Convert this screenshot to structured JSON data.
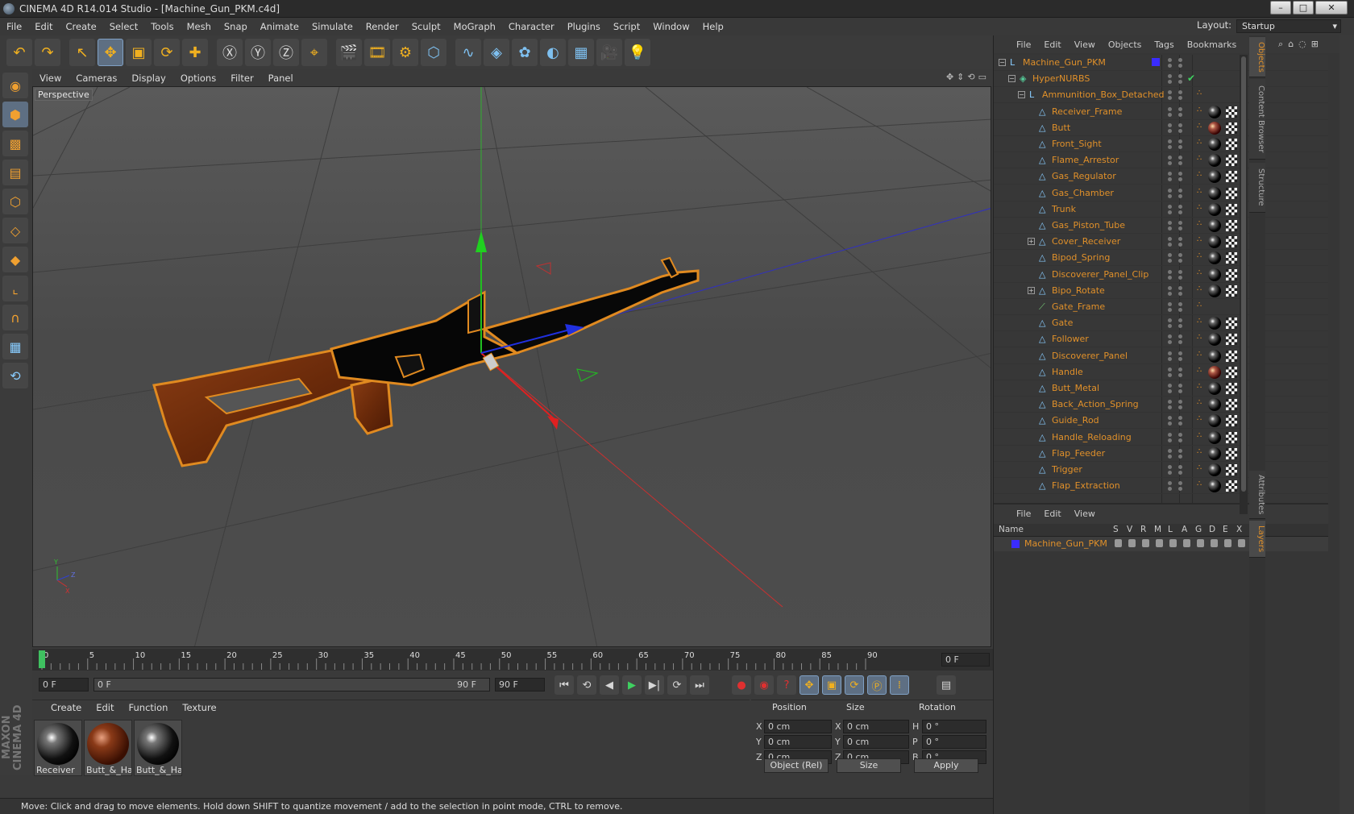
{
  "window": {
    "title": "CINEMA 4D R14.014 Studio - [Machine_Gun_PKM.c4d]",
    "min": "–",
    "max": "□",
    "close": "✕"
  },
  "menu": [
    "File",
    "Edit",
    "Create",
    "Select",
    "Tools",
    "Mesh",
    "Snap",
    "Animate",
    "Simulate",
    "Render",
    "Sculpt",
    "MoGraph",
    "Character",
    "Plugins",
    "Script",
    "Window",
    "Help"
  ],
  "layout": {
    "label": "Layout:",
    "value": "Startup"
  },
  "toolbar_icons": [
    "undo-icon",
    "redo-icon",
    "live-selection-icon",
    "move-icon",
    "scale-icon",
    "rotate-icon",
    "last-tool-icon",
    "x-axis-icon",
    "y-axis-icon",
    "z-axis-icon",
    "coordinate-system-icon",
    "render-view-icon",
    "render-picture-viewer-icon",
    "render-settings-icon",
    "cube-icon",
    "spline-icon",
    "nurbs-icon",
    "array-icon",
    "deformer-icon",
    "floor-icon",
    "camera-icon",
    "light-icon"
  ],
  "toolbar_glyphs": [
    "↶",
    "↷",
    "↖",
    "✥",
    "▣",
    "⟳",
    "✚",
    "Ⓧ",
    "Ⓨ",
    "Ⓩ",
    "⌖",
    "🎬",
    "🎞",
    "⚙",
    "⬡",
    "∿",
    "◈",
    "✿",
    "◐",
    "▦",
    "🎥",
    "💡"
  ],
  "left_tools": [
    "make-editable-icon",
    "model-mode-icon",
    "texture-mode-icon",
    "workplane-icon",
    "points-mode-icon",
    "edges-mode-icon",
    "polygons-mode-icon",
    "axis-mode-icon",
    "magnet-icon",
    "snap-grid-icon",
    "locked-workplane-icon"
  ],
  "left_glyphs": [
    "◉",
    "⬢",
    "▩",
    "▤",
    "⬡",
    "◇",
    "◆",
    "⌞",
    "∩",
    "▦",
    "⟲"
  ],
  "branding": "MAXON CINEMA 4D",
  "viewport": {
    "menu": [
      "View",
      "Cameras",
      "Display",
      "Options",
      "Filter",
      "Panel"
    ],
    "label": "Perspective",
    "icons": [
      "✥",
      "⇕",
      "⟲",
      "▭"
    ],
    "axis_labels": {
      "y": "Y",
      "x": "X",
      "z": "Z"
    }
  },
  "timeline": {
    "ticks": [
      "0",
      "5",
      "10",
      "15",
      "20",
      "25",
      "30",
      "35",
      "40",
      "45",
      "50",
      "55",
      "60",
      "65",
      "70",
      "75",
      "80",
      "85",
      "90"
    ],
    "current_frame": "0 F",
    "start_field": "0 F",
    "range_start": "0 F",
    "range_end": "90 F",
    "end_field": "90 F",
    "controls": [
      "⏮",
      "⟲",
      "◀",
      "▶",
      "▶|",
      "⟳",
      "⏭"
    ],
    "rec_icons": [
      "●",
      "◉",
      "?"
    ],
    "key_icons": [
      "✥",
      "▣",
      "⟳",
      "Ⓟ",
      "⁞"
    ],
    "timeline_icon": "▤"
  },
  "materials": {
    "menu": [
      "Create",
      "Edit",
      "Function",
      "Texture"
    ],
    "items": [
      {
        "name": "Receiver",
        "type": "black"
      },
      {
        "name": "Butt_&_Ha",
        "type": "wood"
      },
      {
        "name": "Butt_&_Ha",
        "type": "black"
      }
    ]
  },
  "coordinates": {
    "headers": [
      "Position",
      "Size",
      "Rotation"
    ],
    "rows": [
      {
        "pl": "X",
        "pv": "0 cm",
        "sl": "X",
        "sv": "0 cm",
        "rl": "H",
        "rv": "0 °"
      },
      {
        "pl": "Y",
        "pv": "0 cm",
        "sl": "Y",
        "sv": "0 cm",
        "rl": "P",
        "rv": "0 °"
      },
      {
        "pl": "Z",
        "pv": "0 cm",
        "sl": "Z",
        "sv": "0 cm",
        "rl": "B",
        "rv": "0 °"
      }
    ],
    "mode": "Object (Rel)",
    "size_mode": "Size",
    "apply": "Apply"
  },
  "status": "Move: Click and drag to move elements. Hold down SHIFT to quantize movement / add to the selection in point mode, CTRL to remove.",
  "objects": {
    "menu": [
      "File",
      "Edit",
      "View",
      "Objects",
      "Tags",
      "Bookmarks"
    ],
    "search_icons": [
      "⌕",
      "⌂",
      "◌",
      "⊞"
    ],
    "tree": [
      {
        "name": "Machine_Gun_PKM",
        "level": 0,
        "icon": "null",
        "tags": "layer",
        "expand": "−"
      },
      {
        "name": "HyperNURBS",
        "level": 1,
        "icon": "nurbs",
        "tags": "check",
        "expand": "−"
      },
      {
        "name": "Ammunition_Box_Detached",
        "level": 2,
        "icon": "null",
        "tags": "phong",
        "expand": "−"
      },
      {
        "name": "Receiver_Frame",
        "level": 3,
        "icon": "poly",
        "tags": "black"
      },
      {
        "name": "Butt",
        "level": 3,
        "icon": "poly",
        "tags": "brown"
      },
      {
        "name": "Front_Sight",
        "level": 3,
        "icon": "poly",
        "tags": "black"
      },
      {
        "name": "Flame_Arrestor",
        "level": 3,
        "icon": "poly",
        "tags": "black"
      },
      {
        "name": "Gas_Regulator",
        "level": 3,
        "icon": "poly",
        "tags": "black"
      },
      {
        "name": "Gas_Chamber",
        "level": 3,
        "icon": "poly",
        "tags": "black"
      },
      {
        "name": "Trunk",
        "level": 3,
        "icon": "poly",
        "tags": "black"
      },
      {
        "name": "Gas_Piston_Tube",
        "level": 3,
        "icon": "poly",
        "tags": "black"
      },
      {
        "name": "Cover_Receiver",
        "level": 3,
        "icon": "poly",
        "tags": "black",
        "expand": "+"
      },
      {
        "name": "Bipod_Spring",
        "level": 3,
        "icon": "poly",
        "tags": "black"
      },
      {
        "name": "Discoverer_Panel_Clip",
        "level": 3,
        "icon": "poly",
        "tags": "black"
      },
      {
        "name": "Bipo_Rotate",
        "level": 3,
        "icon": "poly",
        "tags": "black",
        "expand": "+"
      },
      {
        "name": "Gate_Frame",
        "level": 3,
        "icon": "spline",
        "tags": "phong"
      },
      {
        "name": "Gate",
        "level": 3,
        "icon": "poly",
        "tags": "black"
      },
      {
        "name": "Follower",
        "level": 3,
        "icon": "poly",
        "tags": "black"
      },
      {
        "name": "Discoverer_Panel",
        "level": 3,
        "icon": "poly",
        "tags": "black"
      },
      {
        "name": "Handle",
        "level": 3,
        "icon": "poly",
        "tags": "brown"
      },
      {
        "name": "Butt_Metal",
        "level": 3,
        "icon": "poly",
        "tags": "black"
      },
      {
        "name": "Back_Action_Spring",
        "level": 3,
        "icon": "poly",
        "tags": "black"
      },
      {
        "name": "Guide_Rod",
        "level": 3,
        "icon": "poly",
        "tags": "black"
      },
      {
        "name": "Handle_Reloading",
        "level": 3,
        "icon": "poly",
        "tags": "black"
      },
      {
        "name": "Flap_Feeder",
        "level": 3,
        "icon": "poly",
        "tags": "black"
      },
      {
        "name": "Trigger",
        "level": 3,
        "icon": "poly",
        "tags": "black"
      },
      {
        "name": "Flap_Extraction",
        "level": 3,
        "icon": "poly",
        "tags": "black"
      }
    ]
  },
  "side_tabs": [
    "Objects",
    "Content Browser",
    "Structure",
    "Attributes",
    "Layers"
  ],
  "layers": {
    "menu": [
      "File",
      "Edit",
      "View"
    ],
    "columns": [
      "Name",
      "S",
      "V",
      "R",
      "M",
      "L",
      "A",
      "G",
      "D",
      "E",
      "X"
    ],
    "row": {
      "name": "Machine_Gun_PKM",
      "color": "#3a2cff"
    }
  },
  "colors": {
    "accent_orange": "#e0902a",
    "selected_blue": "#5e6f83",
    "axis_x": "#e02020",
    "axis_y": "#20c020",
    "axis_z": "#2030e0"
  }
}
